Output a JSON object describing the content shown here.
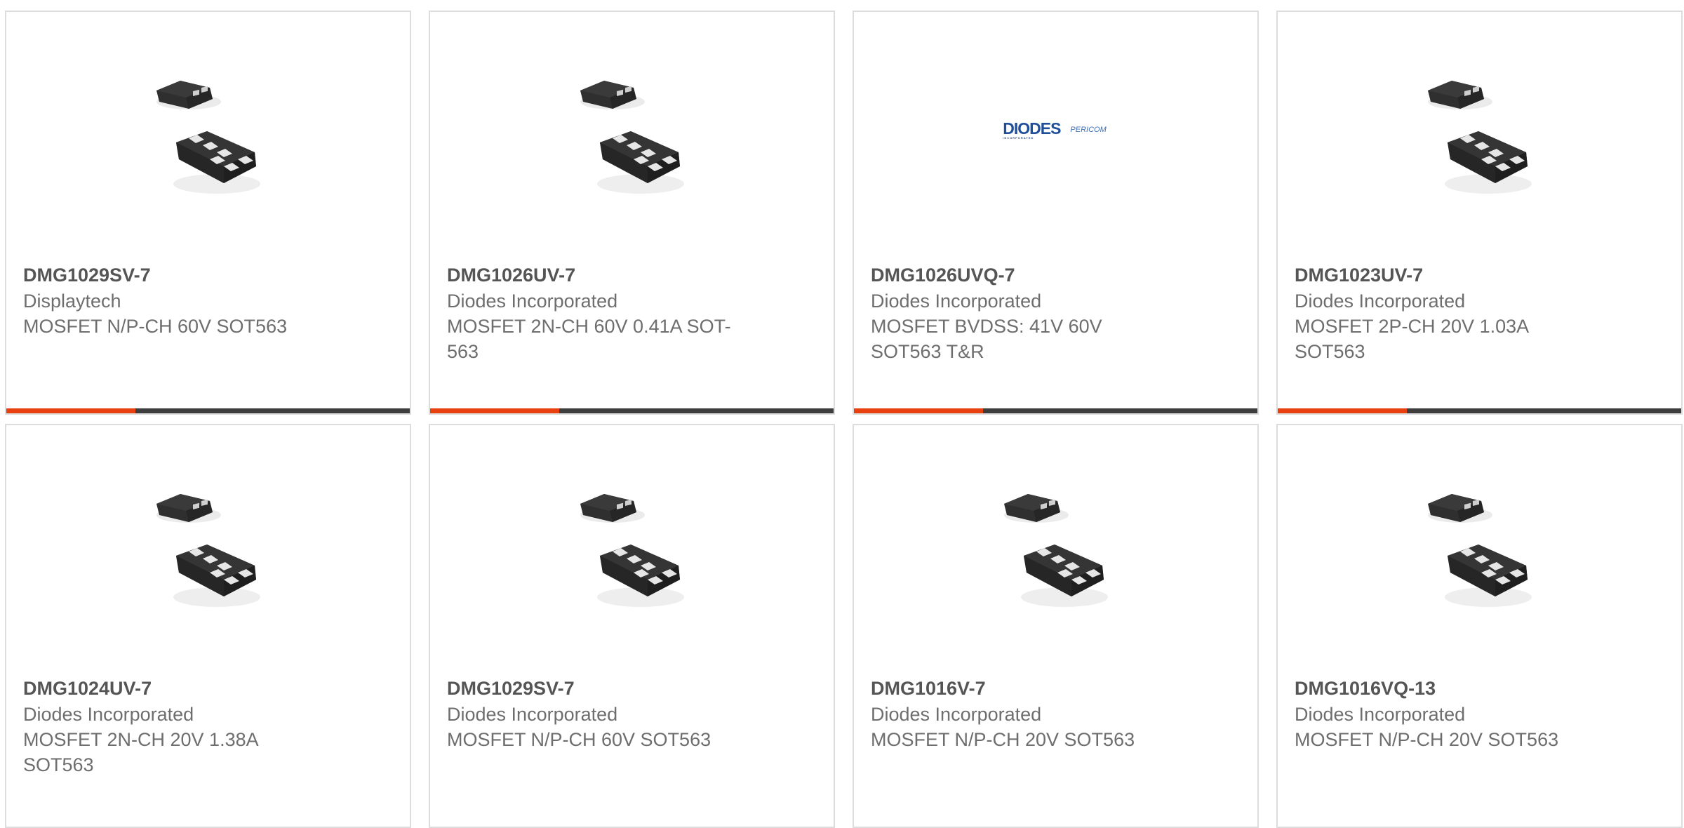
{
  "theme": {
    "accent": "#e8400e",
    "bar_dark": "#3d3d3d",
    "border": "#dcdcdc",
    "part_color": "#555555",
    "text_color": "#6e6e6e"
  },
  "products": [
    {
      "part": "DMG1029SV-7",
      "manufacturer": "Displaytech",
      "description": "MOSFET N/P-CH 60V SOT563",
      "image_icon": "sot563-package-icon",
      "progress_indicator": 0.32
    },
    {
      "part": "DMG1026UV-7",
      "manufacturer": "Diodes Incorporated",
      "description": "MOSFET 2N-CH 60V 0.41A SOT-563",
      "image_icon": "sot563-package-icon",
      "progress_indicator": 0.32
    },
    {
      "part": "DMG1026UVQ-7",
      "manufacturer": "Diodes Incorporated",
      "description": "MOSFET BVDSS: 41V 60V SOT563 T&R",
      "image_icon": "diodes-pericom-logo",
      "logo_text_main": "DIODES",
      "logo_text_sub": "INCORPORATED",
      "logo2_text_main": "PERICOM",
      "progress_indicator": 0.32
    },
    {
      "part": "DMG1023UV-7",
      "manufacturer": "Diodes Incorporated",
      "description": "MOSFET 2P-CH 20V 1.03A SOT563",
      "image_icon": "sot563-package-icon",
      "progress_indicator": 0.32
    },
    {
      "part": "DMG1024UV-7",
      "manufacturer": "Diodes Incorporated",
      "description": "MOSFET 2N-CH 20V 1.38A SOT563",
      "image_icon": "sot563-package-icon"
    },
    {
      "part": "DMG1029SV-7",
      "manufacturer": "Diodes Incorporated",
      "description": "MOSFET N/P-CH 60V SOT563",
      "image_icon": "sot563-package-icon"
    },
    {
      "part": "DMG1016V-7",
      "manufacturer": "Diodes Incorporated",
      "description": "MOSFET N/P-CH 20V SOT563",
      "image_icon": "sot563-package-icon"
    },
    {
      "part": "DMG1016VQ-13",
      "manufacturer": "Diodes Incorporated",
      "description": "MOSFET N/P-CH 20V SOT563",
      "image_icon": "sot563-package-icon"
    }
  ]
}
